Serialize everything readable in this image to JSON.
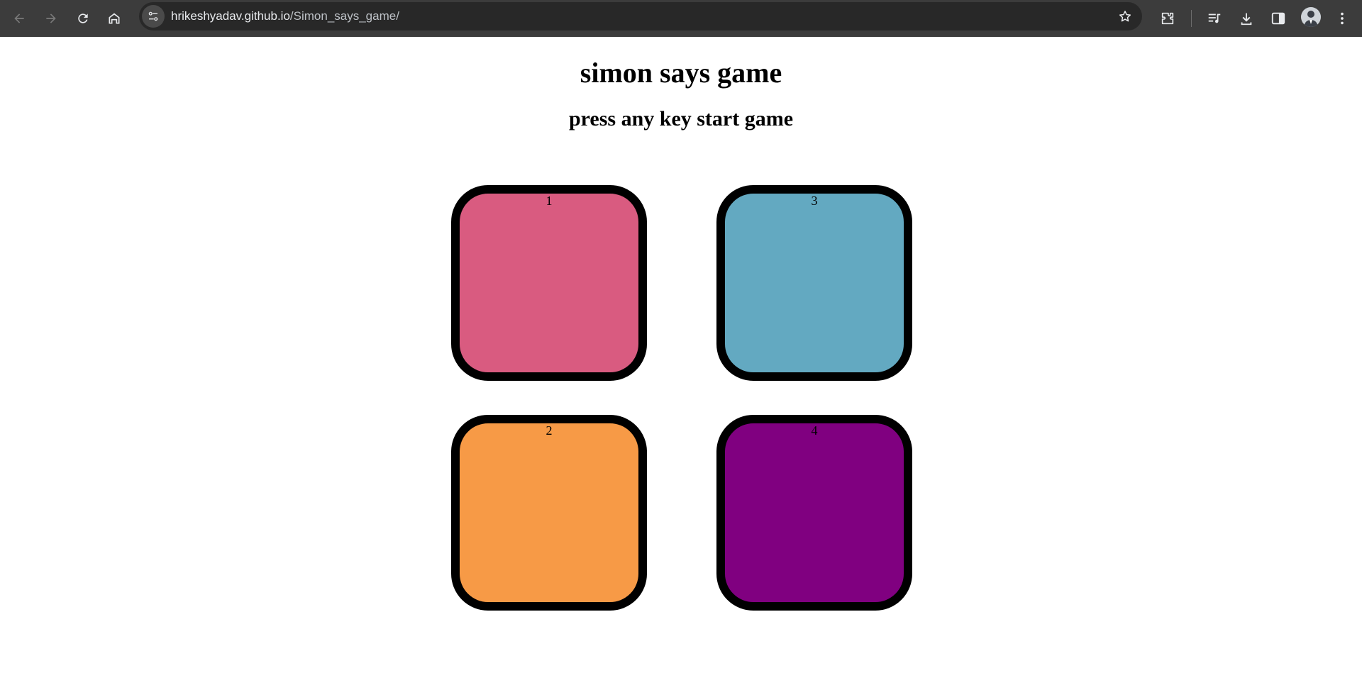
{
  "browser": {
    "url_host": "hrikeshyadav.github.io",
    "url_path": "/Simon_says_game/",
    "icons": {
      "back": "back-arrow-icon",
      "forward": "forward-arrow-icon",
      "reload": "reload-icon",
      "home": "home-icon",
      "site_info": "site-info-icon",
      "bookmark": "star-icon",
      "extensions": "puzzle-icon",
      "media": "media-queue-icon",
      "downloads": "download-icon",
      "side_panel": "side-panel-icon",
      "menu": "kebab-menu-icon"
    }
  },
  "game": {
    "title": "simon says game",
    "status": "press any key start game",
    "buttons": [
      {
        "label": "1",
        "color": "#d95b80"
      },
      {
        "label": "3",
        "color": "#63a9c1"
      },
      {
        "label": "2",
        "color": "#f79a46"
      },
      {
        "label": "4",
        "color": "#800080"
      }
    ]
  }
}
